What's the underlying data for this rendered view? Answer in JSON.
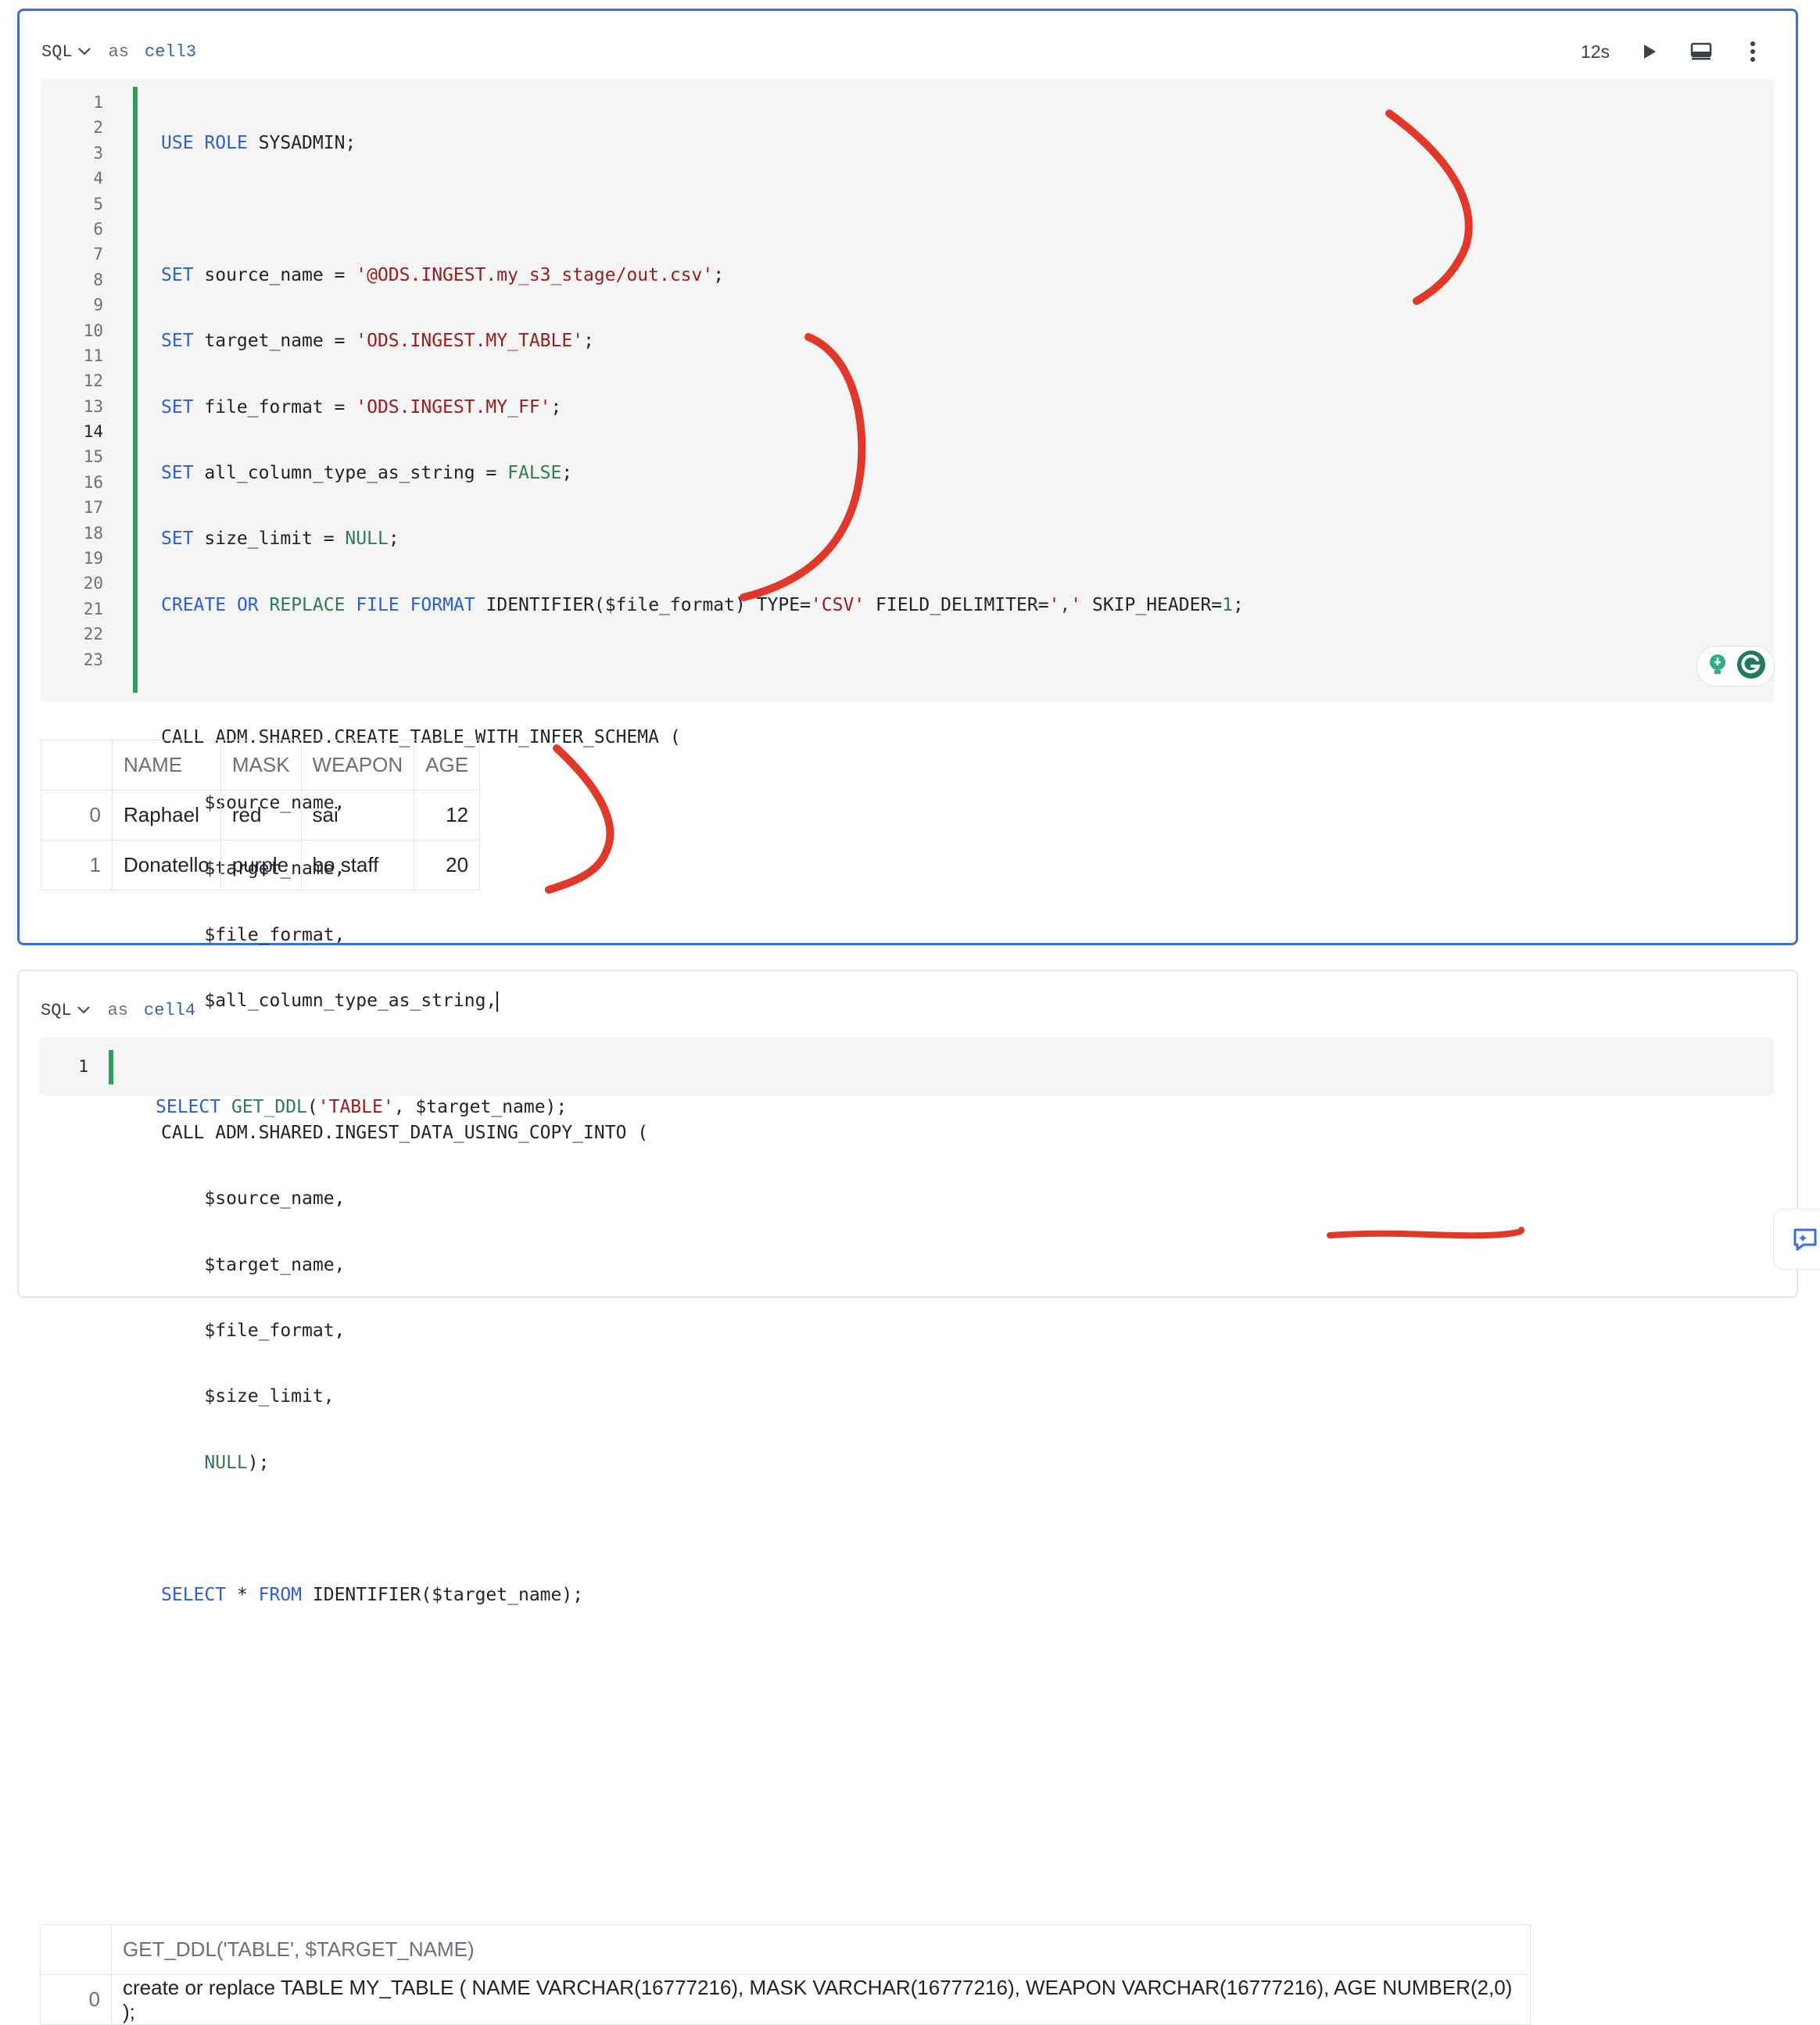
{
  "cell3": {
    "language": "SQL",
    "as_label": "as",
    "cell_name": "cell3",
    "duration": "12s",
    "line_numbers": [
      "1",
      "2",
      "3",
      "4",
      "5",
      "6",
      "7",
      "8",
      "9",
      "10",
      "11",
      "12",
      "13",
      "14",
      "15",
      "16",
      "17",
      "18",
      "19",
      "20",
      "21",
      "22",
      "23"
    ],
    "result": {
      "headers": [
        "",
        "NAME",
        "MASK",
        "WEAPON",
        "AGE"
      ],
      "rows": [
        {
          "index": "0",
          "name": "Raphael",
          "mask": "red",
          "weapon": "sai",
          "age": "12"
        },
        {
          "index": "1",
          "name": "Donatello",
          "mask": "purple",
          "weapon": "bo staff",
          "age": "20"
        }
      ]
    }
  },
  "cell4": {
    "language": "SQL",
    "as_label": "as",
    "cell_name": "cell4",
    "line_numbers": [
      "1"
    ],
    "result": {
      "headers": [
        "",
        "GET_DDL('TABLE', $TARGET_NAME)"
      ],
      "rows": [
        {
          "index": "0",
          "value": "create or replace TABLE MY_TABLE (  NAME VARCHAR(16777216),  MASK VARCHAR(16777216),  WEAPON VARCHAR(16777216),  AGE NUMBER(2,0) );"
        }
      ]
    }
  },
  "colors": {
    "keyword": "#2c5fd1",
    "string": "#9b1c1c",
    "literal": "#2e7d52",
    "selected_border": "#3f6fd3",
    "change_bar": "#2f9e5a",
    "annotation": "#e2382a"
  },
  "icons": [
    "chevron-down-icon",
    "play-icon",
    "display-toggle-icon",
    "more-vertical-icon",
    "lightbulb-icon",
    "grammarly-icon",
    "chat-sparkle-icon"
  ]
}
